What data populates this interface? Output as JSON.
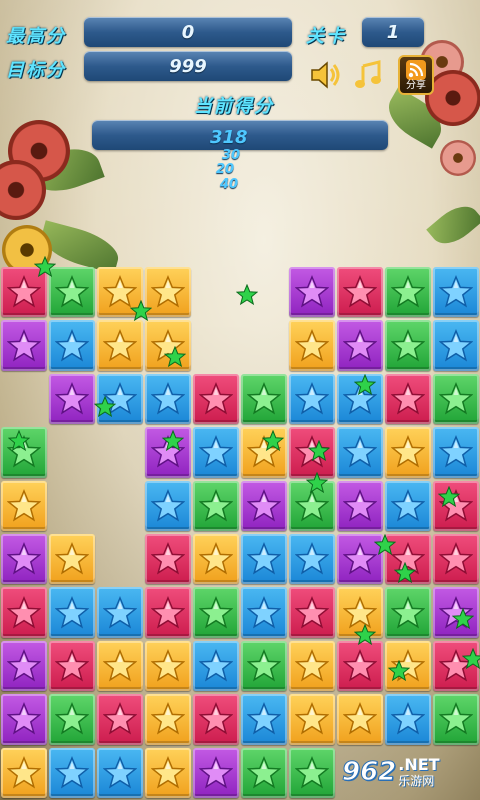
{
  "hud": {
    "best_score_label": "最高分",
    "best_score_value": "0",
    "target_label": "目标分",
    "target_value": "999",
    "level_label": "关卡",
    "level_value": "1",
    "current_score_label": "当前得分",
    "current_score_value": "318",
    "share_label": "分享"
  },
  "popups": [
    "30",
    "20",
    "40"
  ],
  "colors": {
    "blue": "#1a86d6",
    "green": "#20a436",
    "yellow": "#f0a01c",
    "purple": "#8e22bf",
    "red": "#cc1c4d",
    "hud_text": "#5fe4ff"
  },
  "board": {
    "columns": 10,
    "rows": 10,
    "grid": [
      [
        "red",
        "green",
        "yellow",
        "yellow",
        "",
        "",
        "purple",
        "red",
        "green",
        "blue"
      ],
      [
        "purple",
        "blue",
        "yellow",
        "yellow",
        "",
        "",
        "yellow",
        "purple",
        "green",
        "blue"
      ],
      [
        "",
        "purple",
        "blue",
        "blue",
        "red",
        "green",
        "blue",
        "blue",
        "red",
        "green"
      ],
      [
        "green",
        "",
        "",
        "purple",
        "blue",
        "yellow",
        "red",
        "blue",
        "yellow",
        "blue"
      ],
      [
        "yellow",
        "",
        "",
        "blue",
        "green",
        "purple",
        "green",
        "purple",
        "blue",
        "red"
      ],
      [
        "purple",
        "yellow",
        "",
        "red",
        "yellow",
        "blue",
        "blue",
        "purple",
        "red",
        "red"
      ],
      [
        "red",
        "blue",
        "blue",
        "red",
        "green",
        "blue",
        "red",
        "yellow",
        "green",
        "purple"
      ],
      [
        "purple",
        "red",
        "yellow",
        "yellow",
        "blue",
        "green",
        "yellow",
        "red",
        "yellow",
        "red"
      ],
      [
        "purple",
        "green",
        "red",
        "yellow",
        "red",
        "blue",
        "yellow",
        "yellow",
        "blue",
        "green"
      ],
      [
        "yellow",
        "blue",
        "blue",
        "yellow",
        "purple",
        "green",
        "green",
        "",
        "",
        ""
      ]
    ]
  },
  "watermark": {
    "number": "962",
    "suffix": ".NET",
    "subtitle": "乐游网"
  }
}
